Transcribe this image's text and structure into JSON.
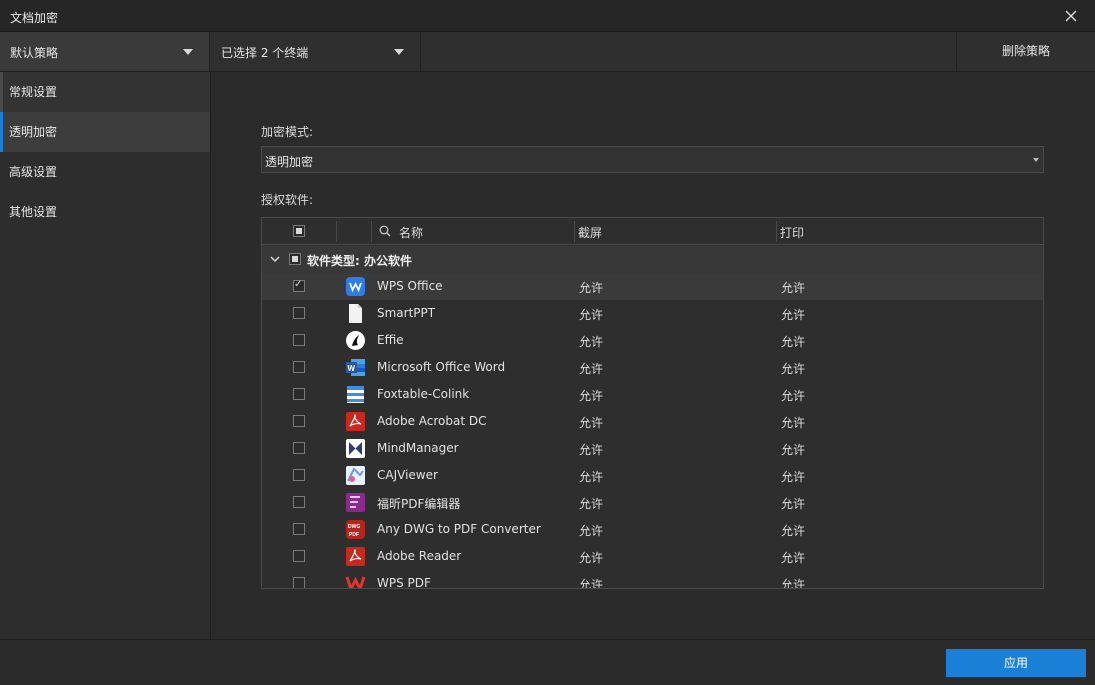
{
  "window": {
    "title": "文档加密"
  },
  "toolbar": {
    "policy": "默认策略",
    "terminals": "已选择 2 个终端",
    "delete_label": "删除策略"
  },
  "sidebar": {
    "items": [
      {
        "label": "常规设置"
      },
      {
        "label": "透明加密"
      },
      {
        "label": "高级设置"
      },
      {
        "label": "其他设置"
      }
    ]
  },
  "main": {
    "mode_label": "加密模式:",
    "mode_value": "透明加密",
    "software_label": "授权软件:",
    "table": {
      "headers": {
        "name": "名称",
        "screenshot": "截屏",
        "print": "打印"
      },
      "group": {
        "label": "软件类型: 办公软件"
      },
      "rows": [
        {
          "name": "WPS Office",
          "screenshot": "允许",
          "print": "允许",
          "checked": true,
          "icon": "wps-office-icon",
          "color": "#2b7de9"
        },
        {
          "name": "SmartPPT",
          "screenshot": "允许",
          "print": "允许",
          "checked": false,
          "icon": "document-icon",
          "color": "#f2f2f2"
        },
        {
          "name": "Effie",
          "screenshot": "允许",
          "print": "允许",
          "checked": false,
          "icon": "effie-icon",
          "color": "#ffffff"
        },
        {
          "name": "Microsoft Office Word",
          "screenshot": "允许",
          "print": "允许",
          "checked": false,
          "icon": "word-icon",
          "color": "#2b579a"
        },
        {
          "name": "Foxtable-Colink",
          "screenshot": "允许",
          "print": "允许",
          "checked": false,
          "icon": "foxtable-icon",
          "color": "#3a8fe0"
        },
        {
          "name": "Adobe Acrobat DC",
          "screenshot": "允许",
          "print": "允许",
          "checked": false,
          "icon": "acrobat-icon",
          "color": "#c8281e"
        },
        {
          "name": "MindManager",
          "screenshot": "允许",
          "print": "允许",
          "checked": false,
          "icon": "mindmanager-icon",
          "color": "#2a3f7a"
        },
        {
          "name": "CAJViewer",
          "screenshot": "允许",
          "print": "允许",
          "checked": false,
          "icon": "cajviewer-icon",
          "color": "#6a9fd8"
        },
        {
          "name": "福昕PDF编辑器",
          "screenshot": "允许",
          "print": "允许",
          "checked": false,
          "icon": "foxit-icon",
          "color": "#8a2a8e"
        },
        {
          "name": "Any DWG to PDF Converter",
          "screenshot": "允许",
          "print": "允许",
          "checked": false,
          "icon": "dwg-pdf-icon",
          "color": "#b3261e"
        },
        {
          "name": "Adobe Reader",
          "screenshot": "允许",
          "print": "允许",
          "checked": false,
          "icon": "adobe-reader-icon",
          "color": "#c8281e"
        },
        {
          "name": "WPS PDF",
          "screenshot": "允许",
          "print": "允许",
          "checked": false,
          "icon": "wps-pdf-icon",
          "color": "#e0352b"
        }
      ]
    }
  },
  "footer": {
    "apply_label": "应用"
  },
  "colors": {
    "accent": "#1a7fd6",
    "background": "#2b2b2b"
  }
}
